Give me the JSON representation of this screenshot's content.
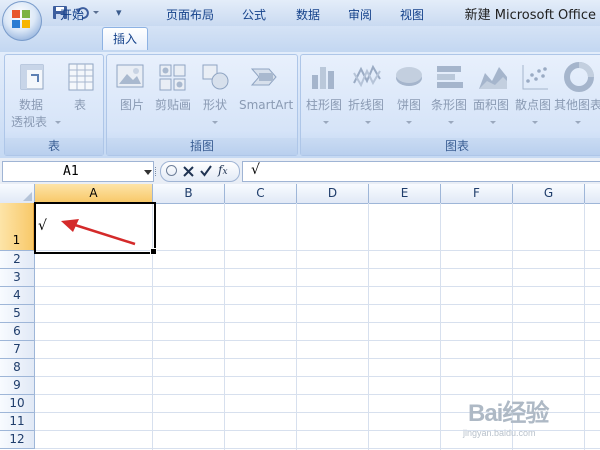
{
  "window": {
    "title": "新建 Microsoft Office"
  },
  "tabs": [
    {
      "label": "开始"
    },
    {
      "label": "插入",
      "active": true
    },
    {
      "label": "页面布局"
    },
    {
      "label": "公式"
    },
    {
      "label": "数据"
    },
    {
      "label": "审阅"
    },
    {
      "label": "视图"
    }
  ],
  "ribbon": {
    "groups": [
      {
        "label": "表",
        "items": [
          {
            "label1": "数据",
            "label2": "透视表",
            "icon": "pivot-table-icon"
          },
          {
            "label1": "表",
            "label2": "",
            "icon": "table-icon"
          }
        ]
      },
      {
        "label": "插图",
        "items": [
          {
            "label1": "图片",
            "icon": "picture-icon"
          },
          {
            "label1": "剪贴画",
            "icon": "clip-art-icon"
          },
          {
            "label1": "形状",
            "icon": "shapes-icon"
          },
          {
            "label1": "SmartArt",
            "icon": "smartart-icon"
          }
        ]
      },
      {
        "label": "图表",
        "items": [
          {
            "label1": "柱形图",
            "icon": "column-chart-icon"
          },
          {
            "label1": "折线图",
            "icon": "line-chart-icon"
          },
          {
            "label1": "饼图",
            "icon": "pie-chart-icon"
          },
          {
            "label1": "条形图",
            "icon": "bar-chart-icon"
          },
          {
            "label1": "面积图",
            "icon": "area-chart-icon"
          },
          {
            "label1": "散点图",
            "icon": "scatter-chart-icon"
          },
          {
            "label1": "其他图表",
            "icon": "other-charts-icon"
          }
        ]
      }
    ]
  },
  "formula_bar": {
    "name_box": "A1",
    "formula": "√"
  },
  "grid": {
    "columns": [
      "A",
      "B",
      "C",
      "D",
      "E",
      "F",
      "G"
    ],
    "rows": [
      "1",
      "2",
      "3",
      "4",
      "5",
      "6",
      "7",
      "8",
      "9",
      "10",
      "11",
      "12"
    ],
    "cells": {
      "A1": "√"
    }
  },
  "annotation": {
    "arrow_color": "#d42a2a"
  },
  "watermark": {
    "main": "Bai经验",
    "sub": "jingyan.baidu.com"
  }
}
